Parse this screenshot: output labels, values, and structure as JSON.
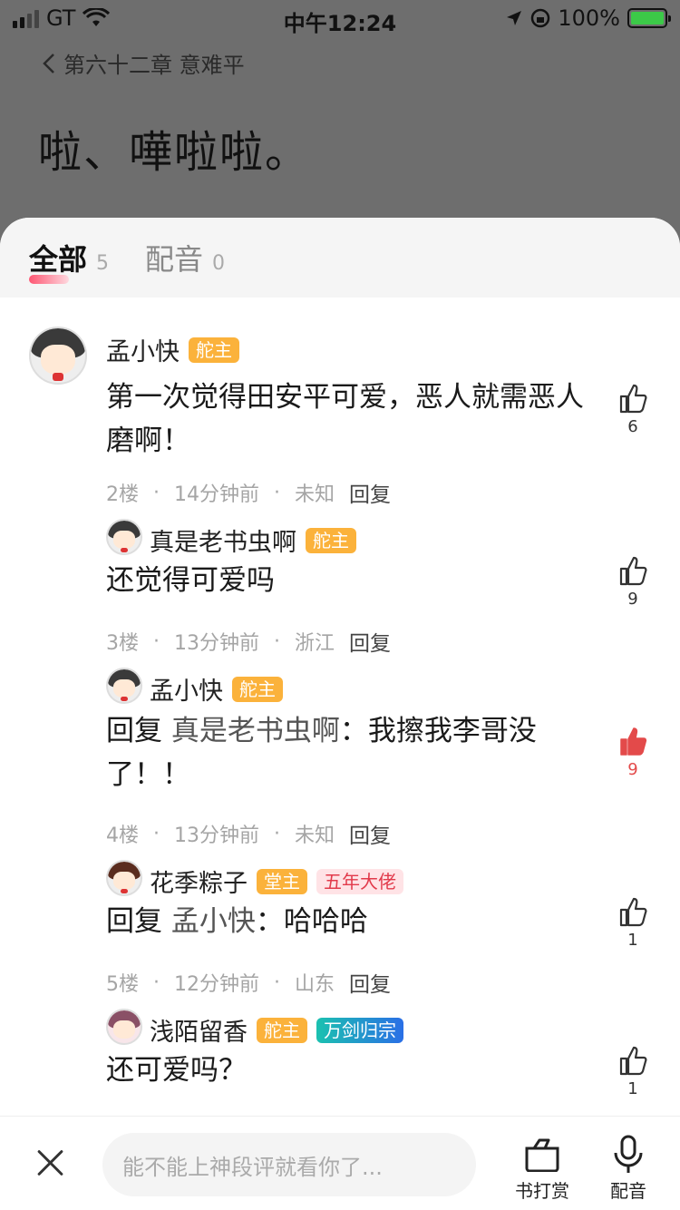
{
  "status": {
    "carrier": "GT",
    "time": "中午12:24",
    "battery": "100%"
  },
  "chapter": {
    "title": "第六十二章 意难平",
    "reader_text": "啦、嘩啦啦。"
  },
  "tabs": [
    {
      "label": "全部",
      "count": "5"
    },
    {
      "label": "配音",
      "count": "0"
    }
  ],
  "comments": [
    {
      "name": "孟小快",
      "badges": [
        "舵主"
      ],
      "text": "第一次觉得田安平可爱，恶人就需恶人磨啊！",
      "floor": "2楼",
      "time": "14分钟前",
      "location": "未知",
      "reply_label": "回复",
      "likes": "6",
      "liked": false
    },
    {
      "name": "真是老书虫啊",
      "badges": [
        "舵主"
      ],
      "text": "还觉得可爱吗",
      "floor": "3楼",
      "time": "13分钟前",
      "location": "浙江",
      "reply_label": "回复",
      "likes": "9",
      "liked": false
    },
    {
      "name": "孟小快",
      "badges": [
        "舵主"
      ],
      "reply_prefix": "回复 ",
      "reply_to": "真是老书虫啊",
      "text": "：我擦我李哥没了！！",
      "floor": "4楼",
      "time": "13分钟前",
      "location": "未知",
      "reply_label": "回复",
      "likes": "9",
      "liked": true
    },
    {
      "name": "花季粽子",
      "badges": [
        "堂主",
        "五年大佬"
      ],
      "reply_prefix": "回复 ",
      "reply_to": "孟小快",
      "text": "：哈哈哈",
      "floor": "5楼",
      "time": "12分钟前",
      "location": "山东",
      "reply_label": "回复",
      "likes": "1",
      "liked": false
    },
    {
      "name": "浅陌留香",
      "badges": [
        "舵主",
        "万剑归宗"
      ],
      "text": "还可爱吗？",
      "likes": "1",
      "liked": false
    }
  ],
  "bottom": {
    "placeholder": "能不能上神段评就看你了...",
    "reward_label": "书打赏",
    "dub_label": "配音"
  },
  "colors": {
    "accent": "#fbb23b",
    "like_active": "#e34a4a"
  }
}
